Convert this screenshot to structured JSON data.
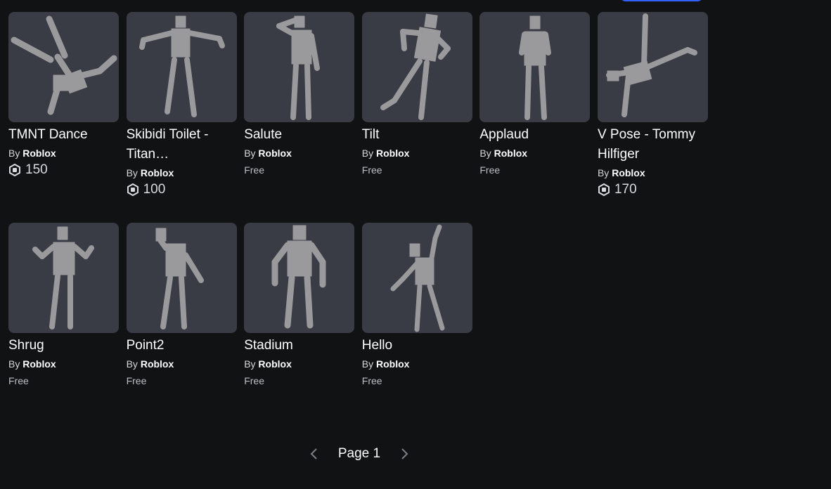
{
  "colors": {
    "background": "#111214",
    "card_thumb": "#393b45",
    "figure": "#9a9a9c",
    "accent": "#335fff"
  },
  "items": [
    {
      "name": "TMNT Dance",
      "by_prefix": "By",
      "creator": "Roblox",
      "price": "150",
      "price_type": "robux",
      "icon": "robux-icon"
    },
    {
      "name": "Skibidi Toilet - Titan…",
      "by_prefix": "By",
      "creator": "Roblox",
      "price": "100",
      "price_type": "robux",
      "icon": "robux-icon"
    },
    {
      "name": "Salute",
      "by_prefix": "By",
      "creator": "Roblox",
      "price": "Free",
      "price_type": "free"
    },
    {
      "name": "Tilt",
      "by_prefix": "By",
      "creator": "Roblox",
      "price": "Free",
      "price_type": "free"
    },
    {
      "name": "Applaud",
      "by_prefix": "By",
      "creator": "Roblox",
      "price": "Free",
      "price_type": "free"
    },
    {
      "name": "V Pose - Tommy Hilfiger",
      "by_prefix": "By",
      "creator": "Roblox",
      "price": "170",
      "price_type": "robux",
      "icon": "robux-icon"
    },
    {
      "name": "Shrug",
      "by_prefix": "By",
      "creator": "Roblox",
      "price": "Free",
      "price_type": "free"
    },
    {
      "name": "Point2",
      "by_prefix": "By",
      "creator": "Roblox",
      "price": "Free",
      "price_type": "free"
    },
    {
      "name": "Stadium",
      "by_prefix": "By",
      "creator": "Roblox",
      "price": "Free",
      "price_type": "free"
    },
    {
      "name": "Hello",
      "by_prefix": "By",
      "creator": "Roblox",
      "price": "Free",
      "price_type": "free"
    }
  ],
  "pagination": {
    "label": "Page 1",
    "prev_icon": "chevron-left-icon",
    "next_icon": "chevron-right-icon"
  }
}
